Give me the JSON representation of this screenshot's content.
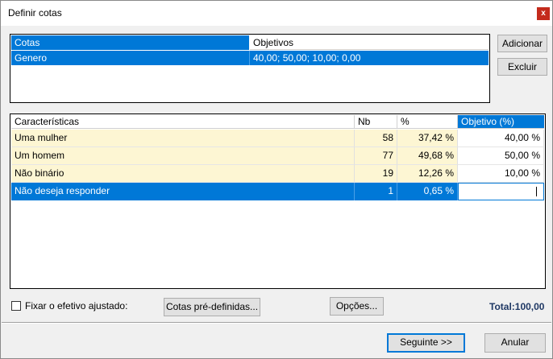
{
  "window": {
    "title": "Definir cotas",
    "close_glyph": "x"
  },
  "quotas_table": {
    "headers": [
      "Cotas",
      "Objetivos"
    ],
    "rows": [
      {
        "name": "Genero",
        "objectives": "40,00; 50,00; 10,00; 0,00"
      }
    ]
  },
  "side_buttons": {
    "add": "Adicionar",
    "delete": "Excluir"
  },
  "characteristics_table": {
    "headers": [
      "Características",
      "Nb",
      "%",
      "Objetivo (%)"
    ],
    "rows": [
      {
        "label": "Uma mulher",
        "nb": "58",
        "pct": "37,42 %",
        "objective": "40,00 %"
      },
      {
        "label": "Um homem",
        "nb": "77",
        "pct": "49,68 %",
        "objective": "50,00 %"
      },
      {
        "label": "Não binário",
        "nb": "19",
        "pct": "12,26 %",
        "objective": "10,00 %"
      },
      {
        "label": "Não deseja responder",
        "nb": "1",
        "pct": "0,65 %",
        "objective": ""
      }
    ]
  },
  "footer": {
    "fix_label": "Fixar o efetivo ajustado:",
    "fix_checked": false,
    "predefined_button": "Cotas pré-definidas...",
    "options_button": "Opções...",
    "total_label": "Total:",
    "total_value": "100,00",
    "next_button": "Seguinte >>",
    "cancel_button": "Anular"
  },
  "colors": {
    "selection": "#0078d7",
    "row_highlight": "#fdf6d3",
    "total_text": "#1f3864"
  }
}
